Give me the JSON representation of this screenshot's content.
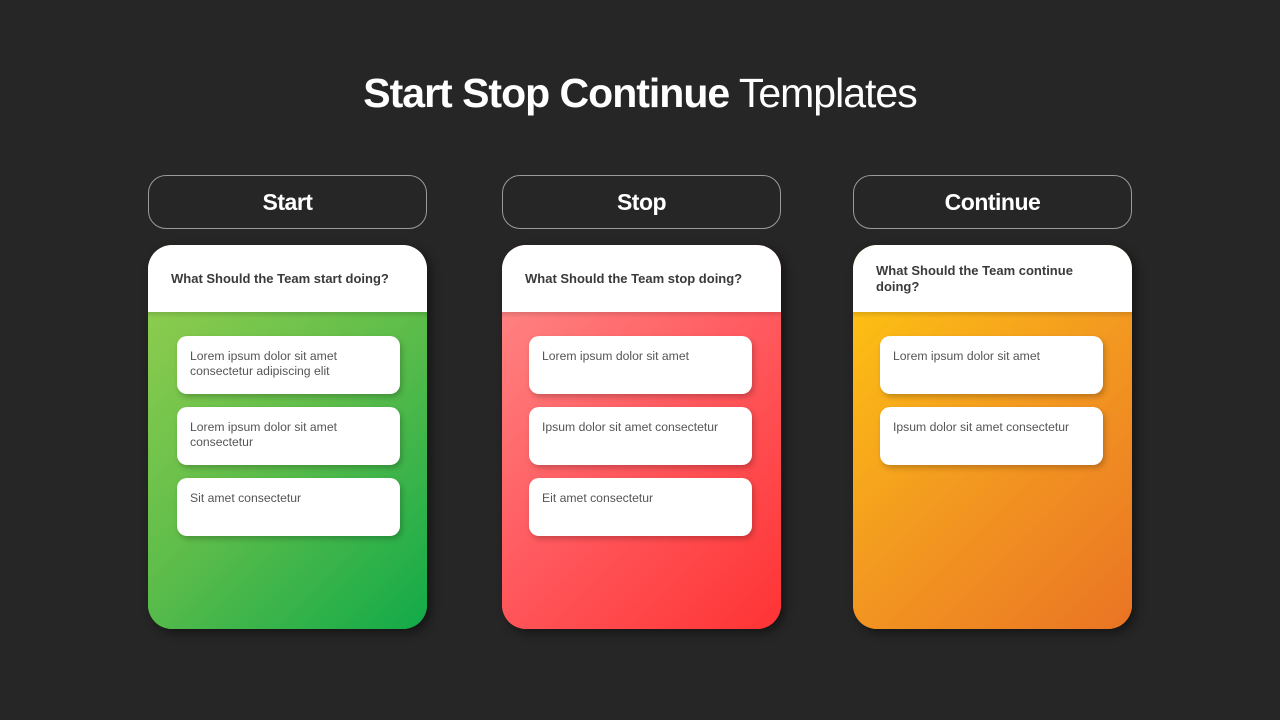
{
  "title": {
    "bold": "Start Stop Continue",
    "light": "Templates"
  },
  "columns": [
    {
      "header": "Start",
      "question": "What Should the Team start doing?",
      "color": "#5fbd4a",
      "items": [
        "Lorem ipsum dolor sit amet consectetur adipiscing elit",
        "Lorem ipsum dolor sit amet consectetur",
        "Sit amet consectetur"
      ]
    },
    {
      "header": "Stop",
      "question": "What Should the Team stop doing?",
      "color": "#ff4a4e",
      "items": [
        "Lorem ipsum dolor sit amet",
        "Ipsum dolor sit amet consectetur",
        "Eit amet consectetur"
      ]
    },
    {
      "header": "Continue",
      "question": "What Should the Team continue doing?",
      "color": "#f39a20",
      "items": [
        "Lorem ipsum dolor sit amet",
        "Ipsum dolor sit amet consectetur"
      ]
    }
  ]
}
